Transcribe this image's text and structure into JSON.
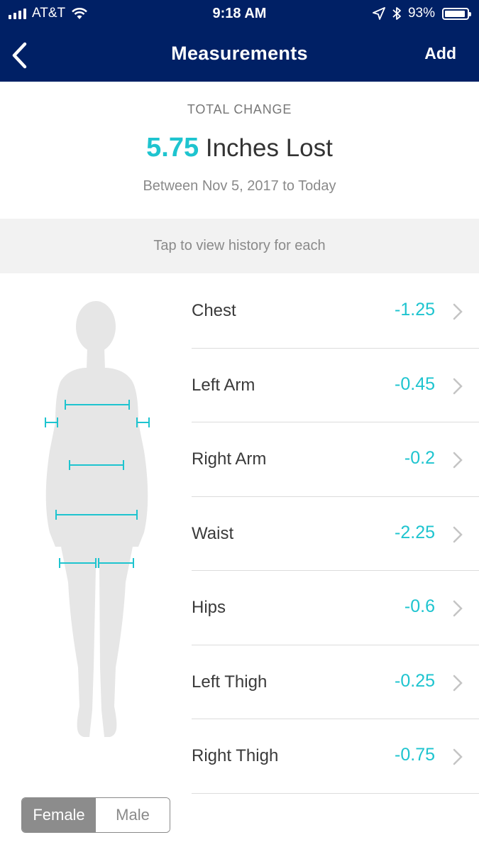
{
  "status_bar": {
    "carrier": "AT&T",
    "time": "9:18 AM",
    "battery": "93%",
    "battery_level": 0.93
  },
  "nav": {
    "title": "Measurements",
    "add_label": "Add"
  },
  "summary": {
    "label": "TOTAL CHANGE",
    "value": "5.75",
    "unit_text": "Inches Lost",
    "range": "Between Nov 5, 2017 to Today"
  },
  "hint": "Tap to view history for each",
  "measurements": [
    {
      "name": "Chest",
      "value": "-1.25"
    },
    {
      "name": "Left Arm",
      "value": "-0.45"
    },
    {
      "name": "Right Arm",
      "value": "-0.2"
    },
    {
      "name": "Waist",
      "value": "-2.25"
    },
    {
      "name": "Hips",
      "value": "-0.6"
    },
    {
      "name": "Left Thigh",
      "value": "-0.25"
    },
    {
      "name": "Right Thigh",
      "value": "-0.75"
    }
  ],
  "gender_toggle": {
    "options": [
      "Female",
      "Male"
    ],
    "selected": "Female"
  },
  "colors": {
    "header": "#002065",
    "accent": "#1ec4cf"
  }
}
